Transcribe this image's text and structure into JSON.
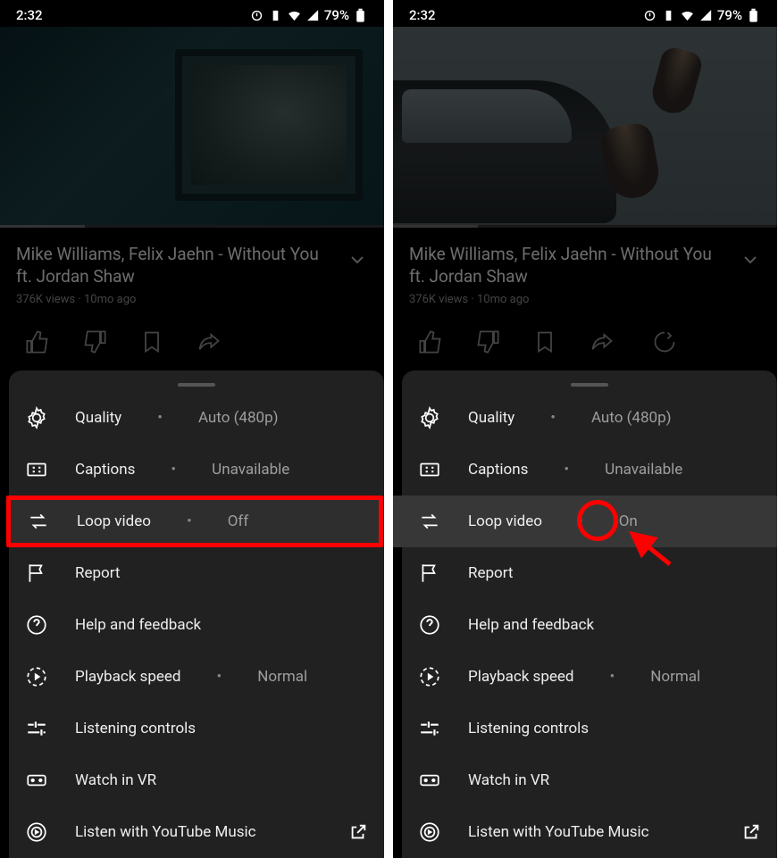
{
  "status": {
    "time": "2:32",
    "battery_pct": "79%"
  },
  "video": {
    "title": "Mike Williams, Felix Jaehn - Without You ft. Jordan Shaw",
    "views": "376K views",
    "age": "10mo ago"
  },
  "menu": {
    "quality": {
      "label": "Quality",
      "value": "Auto (480p)"
    },
    "captions": {
      "label": "Captions",
      "value": "Unavailable"
    },
    "loop": {
      "label": "Loop video",
      "value_off": "Off",
      "value_on": "On"
    },
    "report": {
      "label": "Report"
    },
    "help": {
      "label": "Help and feedback"
    },
    "speed": {
      "label": "Playback speed",
      "value": "Normal"
    },
    "listening": {
      "label": "Listening controls"
    },
    "vr": {
      "label": "Watch in VR"
    },
    "ytmusic": {
      "label": "Listen with YouTube Music"
    }
  }
}
